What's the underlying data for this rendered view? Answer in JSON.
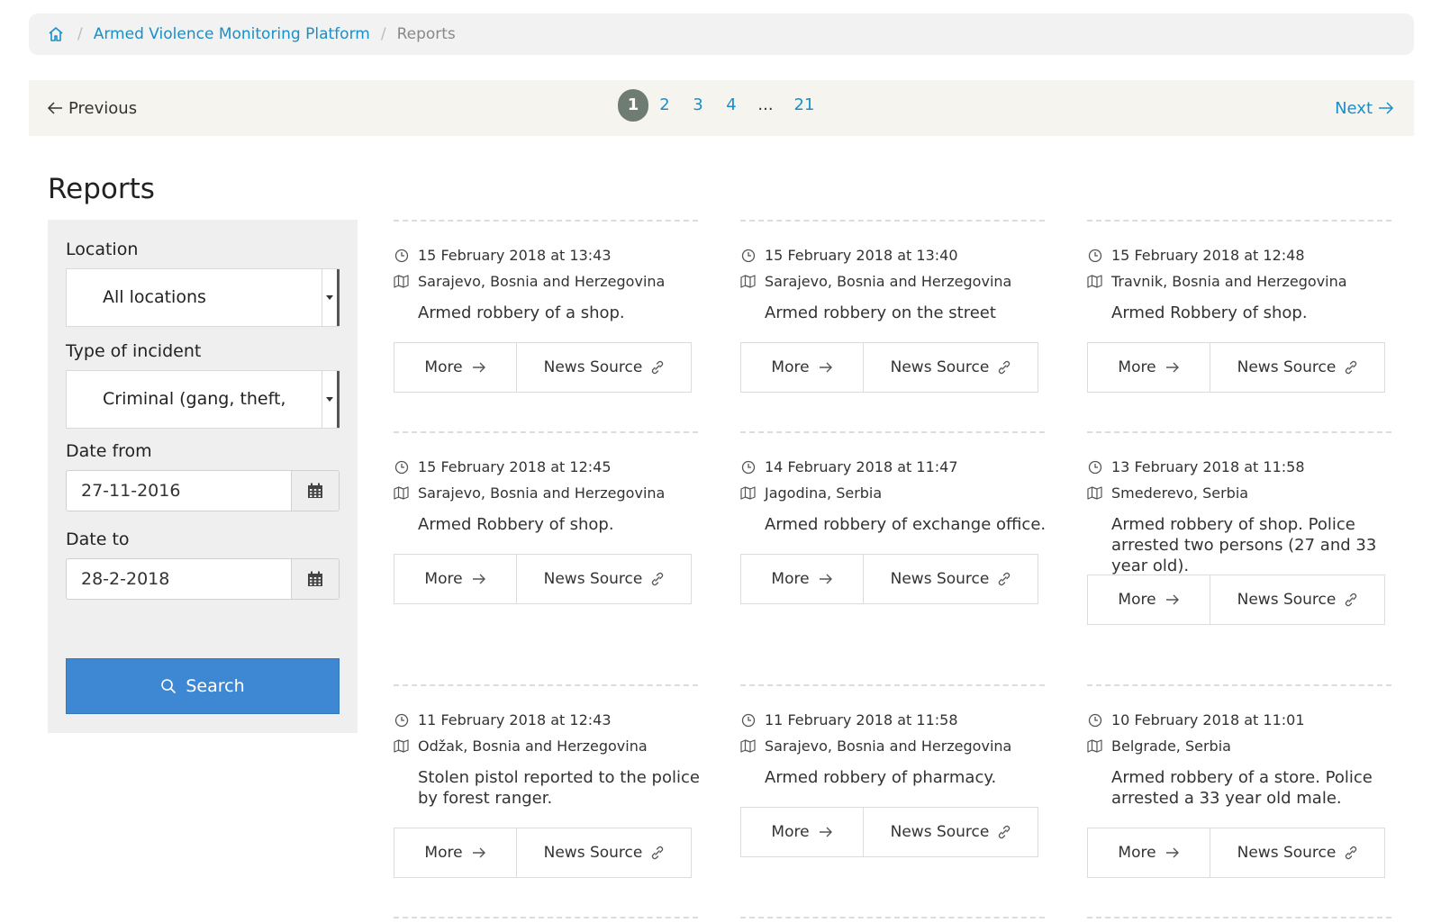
{
  "breadcrumb": {
    "home_icon": "home-icon",
    "separator": "/",
    "platform": "Armed Violence Monitoring Platform",
    "current": "Reports"
  },
  "pagination": {
    "previous": "Previous",
    "next": "Next",
    "pages": [
      "1",
      "2",
      "3",
      "4",
      "...",
      "21"
    ],
    "active": "1"
  },
  "page_title": "Reports",
  "filters": {
    "location_label": "Location",
    "location_value": "All locations",
    "type_label": "Type of incident",
    "type_value": "Criminal (gang, theft, murder)",
    "date_from_label": "Date from",
    "date_from_value": "27-11-2016",
    "date_to_label": "Date to",
    "date_to_value": "28-2-2018",
    "search_label": "Search"
  },
  "cards": [
    {
      "datetime": "15 February 2018 at 13:43",
      "location": "Sarajevo, Bosnia and Herzegovina",
      "description": "Armed robbery of a shop.",
      "more": "More",
      "source": "News Source"
    },
    {
      "datetime": "15 February 2018 at 13:40",
      "location": "Sarajevo, Bosnia and Herzegovina",
      "description": "Armed robbery on the street",
      "more": "More",
      "source": "News Source"
    },
    {
      "datetime": "15 February 2018 at 12:48",
      "location": "Travnik, Bosnia and Herzegovina",
      "description": "Armed Robbery of shop.",
      "more": "More",
      "source": "News Source"
    },
    {
      "datetime": "15 February 2018 at 12:45",
      "location": "Sarajevo, Bosnia and Herzegovina",
      "description": "Armed Robbery of shop.",
      "more": "More",
      "source": "News Source"
    },
    {
      "datetime": "14 February 2018 at 11:47",
      "location": "Jagodina, Serbia",
      "description": "Armed robbery of exchange office.",
      "more": "More",
      "source": "News Source"
    },
    {
      "datetime": "13 February 2018 at 11:58",
      "location": "Smederevo, Serbia",
      "description": "Armed robbery of shop. Police arrested two persons (27 and 33 year old).",
      "more": "More",
      "source": "News Source"
    },
    {
      "datetime": "11 February 2018 at 12:43",
      "location": "Odžak, Bosnia and Herzegovina",
      "description": "Stolen pistol reported to the police by forest ranger.",
      "more": "More",
      "source": "News Source"
    },
    {
      "datetime": "11 February 2018 at 11:58",
      "location": "Sarajevo, Bosnia and Herzegovina",
      "description": "Armed robbery of pharmacy.",
      "more": "More",
      "source": "News Source"
    },
    {
      "datetime": "10 February 2018 at 11:01",
      "location": "Belgrade, Serbia",
      "description": "Armed robbery of a store. Police arrested a 33 year old male.",
      "more": "More",
      "source": "News Source"
    }
  ],
  "colors": {
    "link": "#1a8fc7",
    "active_page": "#6f7c74",
    "search_button": "#3e88d3"
  }
}
